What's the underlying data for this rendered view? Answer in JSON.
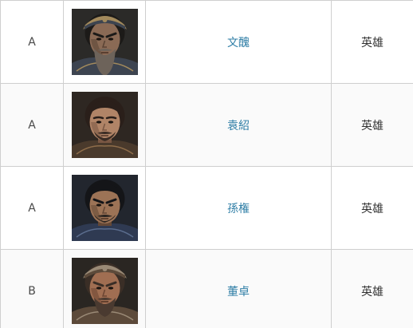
{
  "table": {
    "rows": [
      {
        "rank": "A",
        "name": "文醜",
        "type": "英雄",
        "portrait_icon": "general-portrait-icon",
        "palette": {
          "bg": "#2b2a28",
          "skin": "#8a6a55",
          "skin_shadow": "#5a4334",
          "hair": "#1c1a18",
          "beard": "#6d635a",
          "armor": "#3d4450",
          "accent": "#a38a5c"
        }
      },
      {
        "rank": "A",
        "name": "袁紹",
        "type": "英雄",
        "portrait_icon": "general-portrait-icon",
        "palette": {
          "bg": "#2e2722",
          "skin": "#b08467",
          "skin_shadow": "#7a5743",
          "hair": "#2a1f1a",
          "beard": "#3a2c24",
          "armor": "#4a3a2c",
          "accent": "#8e6d4a"
        }
      },
      {
        "rank": "A",
        "name": "孫権",
        "type": "英雄",
        "portrait_icon": "general-portrait-icon",
        "palette": {
          "bg": "#22262e",
          "skin": "#9c7356",
          "skin_shadow": "#644836",
          "hair": "#141518",
          "beard": "#2a2420",
          "armor": "#2f3a52",
          "accent": "#5b6d8e"
        }
      },
      {
        "rank": "B",
        "name": "董卓",
        "type": "英雄",
        "portrait_icon": "general-portrait-icon",
        "palette": {
          "bg": "#2a2622",
          "skin": "#a06e52",
          "skin_shadow": "#6b4532",
          "hair": "#3a2e26",
          "beard": "#4a3a30",
          "armor": "#5c4a3a",
          "accent": "#9a8a76"
        }
      }
    ]
  }
}
